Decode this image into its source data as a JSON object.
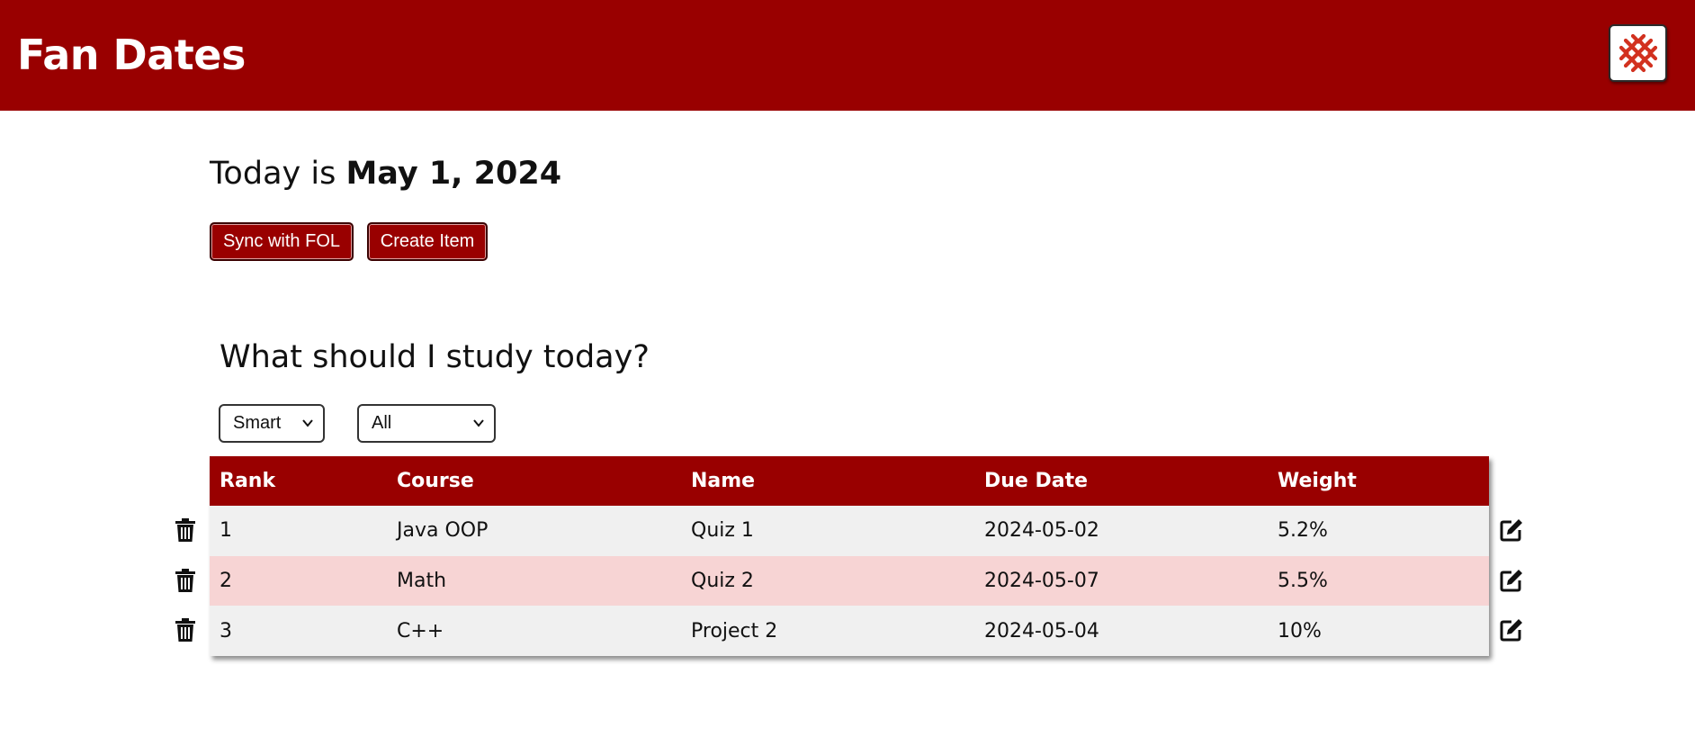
{
  "header": {
    "title": "Fan Dates",
    "logo_icon": "snowflake-logo-icon",
    "brand_color": "#990000"
  },
  "today": {
    "prefix": "Today is",
    "date": "May 1, 2024"
  },
  "actions": {
    "sync_label": "Sync with FOL",
    "create_label": "Create Item"
  },
  "study": {
    "title": "What should I study today?",
    "sort_selected": "Smart",
    "filter_selected": "All"
  },
  "table": {
    "headers": {
      "rank": "Rank",
      "course": "Course",
      "name": "Name",
      "due": "Due Date",
      "weight": "Weight"
    },
    "rows": [
      {
        "rank": "1",
        "course": "Java OOP",
        "name": "Quiz 1",
        "due": "2024-05-02",
        "weight": "5.2%"
      },
      {
        "rank": "2",
        "course": "Math",
        "name": "Quiz 2",
        "due": "2024-05-07",
        "weight": "5.5%"
      },
      {
        "rank": "3",
        "course": "C++",
        "name": "Project 2",
        "due": "2024-05-04",
        "weight": "10%"
      }
    ],
    "row_colors": [
      "#f0f0f0",
      "#f7d4d4"
    ],
    "row_left_icon": "trash-icon",
    "row_right_icon": "edit-icon"
  }
}
